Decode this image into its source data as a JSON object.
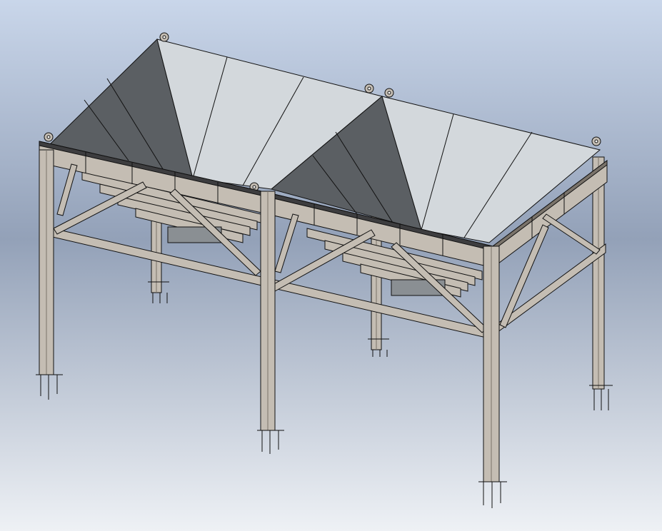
{
  "scene": {
    "subject": "steel-frame-bin-structure",
    "bins": [
      "bin-1",
      "bin-2"
    ],
    "legs": [
      "leg-front-left",
      "leg-front-middle",
      "leg-front-right",
      "leg-back-left",
      "leg-back-middle",
      "leg-back-right"
    ],
    "lifting_lugs": [
      "lug-1",
      "lug-2",
      "lug-3",
      "lug-4",
      "lug-5",
      "lug-6"
    ]
  },
  "colors": {
    "background_top": "#c9d6ea",
    "background_mid": "#93a1b8",
    "background_bottom": "#eef1f5",
    "steel": "#c4bdb3",
    "steel_dark": "#7a736a",
    "steel_shadow": "#3d3d3f",
    "hopper_light": "#d3d8dc",
    "hopper_dark": "#5b5f63",
    "line": "#111111"
  }
}
